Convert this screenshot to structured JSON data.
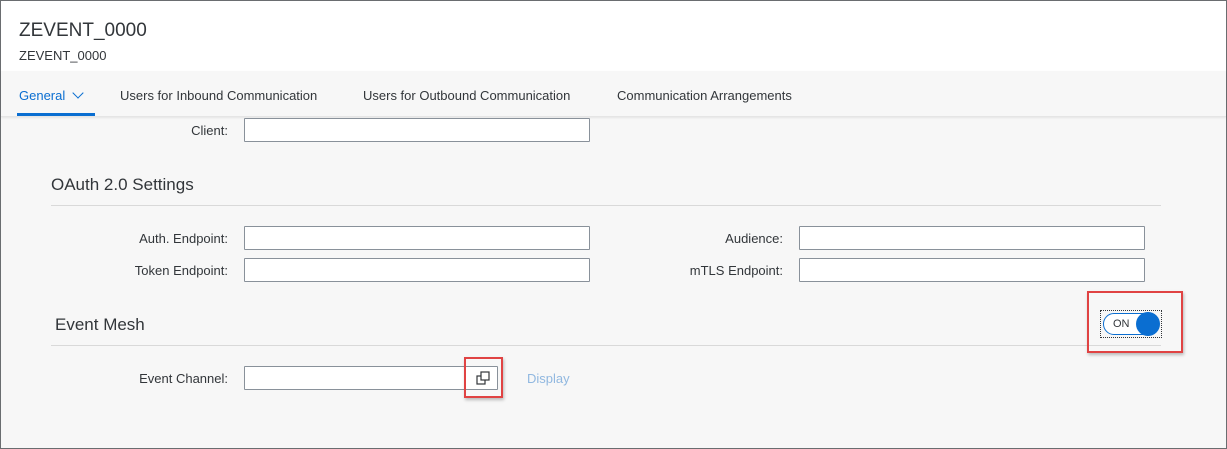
{
  "header": {
    "title": "ZEVENT_0000",
    "subtitle": "ZEVENT_0000"
  },
  "tabs": [
    {
      "label": "General"
    },
    {
      "label": "Users for Inbound Communication"
    },
    {
      "label": "Users for Outbound Communication"
    },
    {
      "label": "Communication Arrangements"
    }
  ],
  "general": {
    "client": {
      "label": "Client:",
      "value": ""
    }
  },
  "oauth": {
    "title": "OAuth 2.0 Settings",
    "auth_endpoint": {
      "label": "Auth. Endpoint:",
      "value": ""
    },
    "token_endpoint": {
      "label": "Token Endpoint:",
      "value": ""
    },
    "audience": {
      "label": "Audience:",
      "value": ""
    },
    "mtls_endpoint": {
      "label": "mTLS Endpoint:",
      "value": ""
    }
  },
  "event_mesh": {
    "title": "Event Mesh",
    "toggle_label": "ON",
    "toggle_state": true,
    "event_channel": {
      "label": "Event Channel:",
      "value": ""
    },
    "display_link": "Display"
  },
  "colors": {
    "accent": "#0a6ed1",
    "highlight": "#e04343",
    "link_disabled": "#91b8e0"
  }
}
